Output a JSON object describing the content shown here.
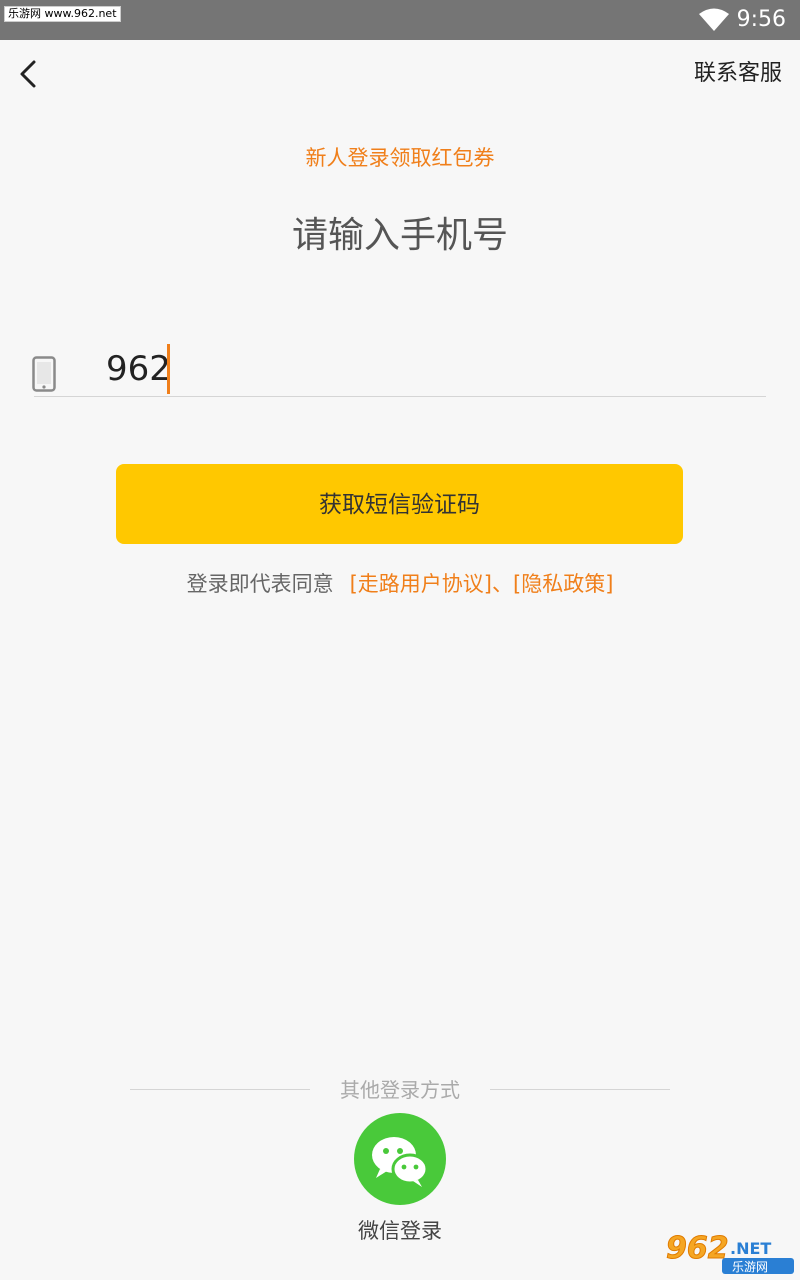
{
  "status_bar": {
    "watermark": "乐游网 www.962.net",
    "time": "9:56",
    "wifi_icon": "wifi-icon"
  },
  "header": {
    "back_icon": "chevron-left-icon",
    "contact_label": "联系客服"
  },
  "promo": "新人登录领取红包券",
  "title": "请输入手机号",
  "phone_field": {
    "icon": "smartphone-icon",
    "value": "962"
  },
  "sms_button_label": "获取短信验证码",
  "agreement": {
    "prefix": "登录即代表同意",
    "user_agreement": "[走路用户协议]",
    "separator": "、",
    "privacy_policy": "[隐私政策]"
  },
  "other_login": {
    "label": "其他登录方式",
    "wechat_icon": "wechat-icon",
    "wechat_label": "微信登录"
  },
  "corner_watermark": {
    "brand": "962.NET",
    "site": "乐游网"
  },
  "colors": {
    "accent_orange": "#f07f1a",
    "button_yellow": "#ffc800",
    "wechat_green": "#49c93a",
    "background": "#f7f7f7",
    "status_bar": "#757575"
  }
}
